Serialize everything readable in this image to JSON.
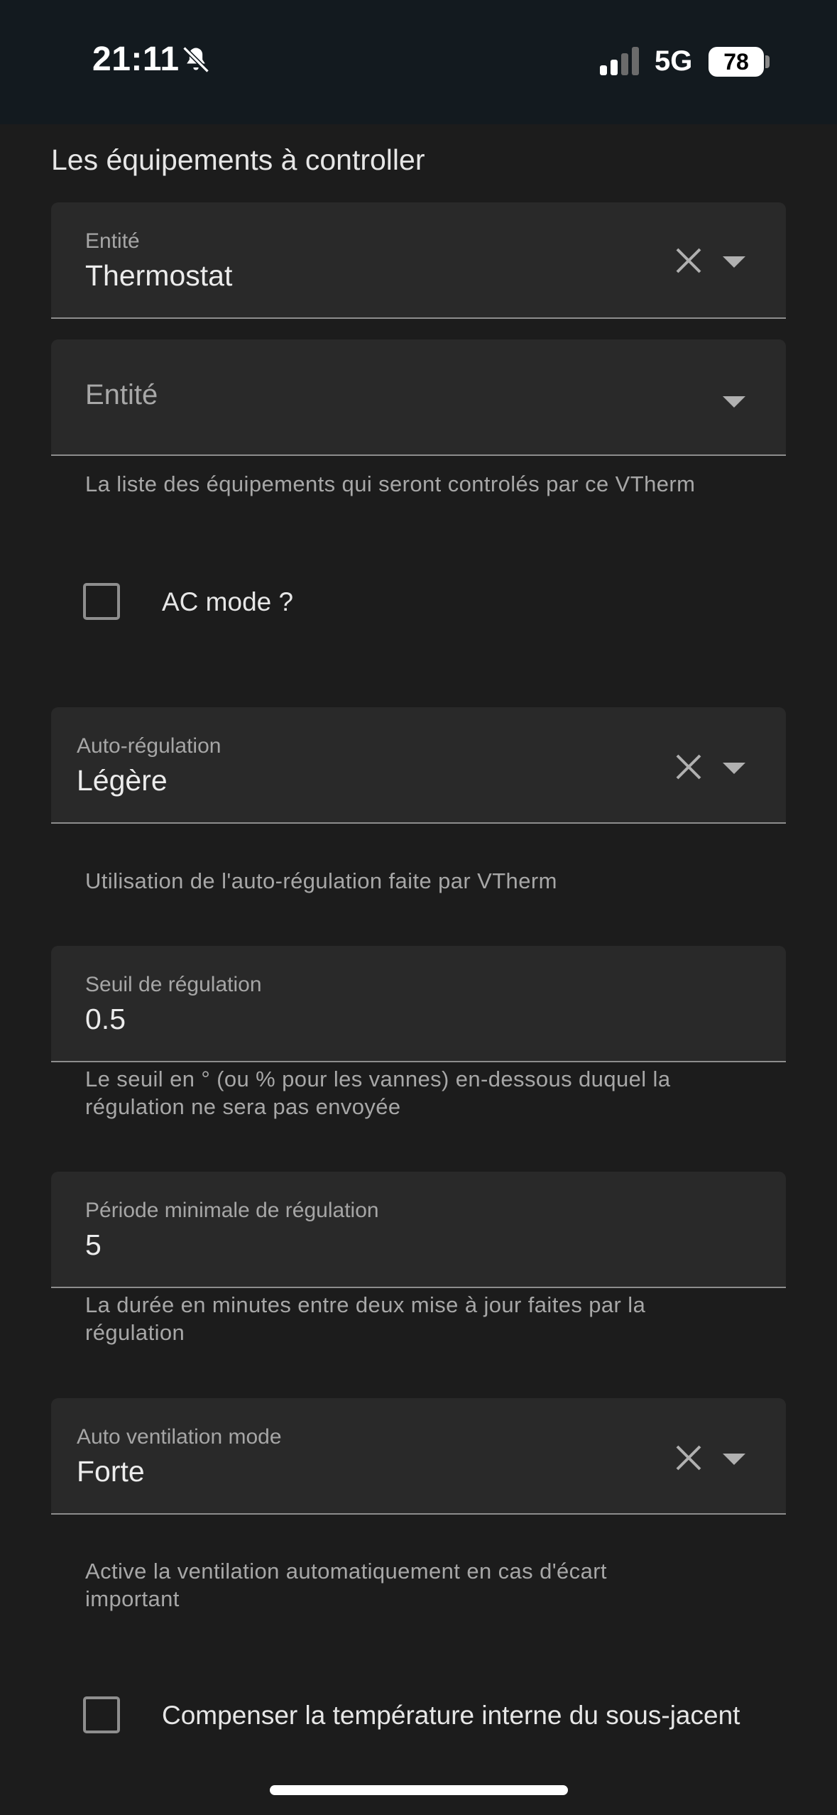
{
  "status_bar": {
    "time": "21:11",
    "network": "5G",
    "battery_level": "78"
  },
  "section_title": "Les équipements à controller",
  "entity_field_1": {
    "label": "Entité",
    "value": "Thermostat"
  },
  "entity_field_2": {
    "placeholder": "Entité"
  },
  "entity_helper": "La liste des équipements qui seront controlés par ce VTherm",
  "ac_mode": {
    "label": "AC mode ?",
    "checked": false
  },
  "auto_regulation": {
    "label": "Auto-régulation",
    "value": "Légère",
    "helper": "Utilisation de l'auto-régulation faite par VTherm"
  },
  "regulation_threshold": {
    "label": "Seuil de régulation",
    "value": "0.5",
    "helper_line1": "Le seuil en ° (ou % pour les vannes) en-dessous duquel la",
    "helper_line2": "régulation ne sera pas envoyée"
  },
  "min_regulation_period": {
    "label": "Période minimale de régulation",
    "value": "5",
    "helper_line1": "La durée en minutes entre deux mise à jour faites par la",
    "helper_line2": "régulation"
  },
  "auto_ventilation": {
    "label": "Auto ventilation mode",
    "value": "Forte",
    "helper_line1": "Active la ventilation automatiquement en cas d'écart",
    "helper_line2": "important"
  },
  "compensate": {
    "label": "Compenser la température interne du sous-jacent",
    "checked": false
  },
  "colors": {
    "background": "#1c1c1c",
    "field_background": "#292929",
    "status_bar": "#131a1f"
  },
  "icons": [
    "bell-slash-icon",
    "signal-icon",
    "battery-icon",
    "close-icon",
    "chevron-down-icon"
  ]
}
